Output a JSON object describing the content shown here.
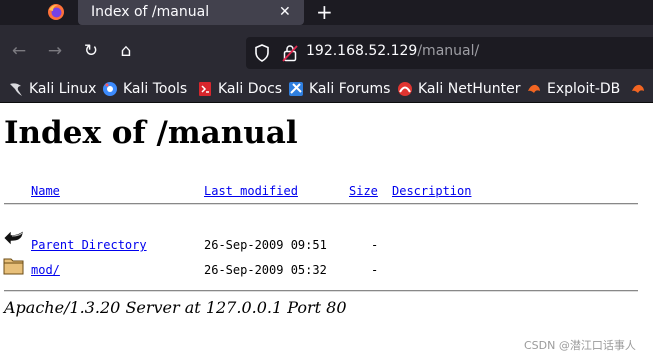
{
  "browser": {
    "tab": {
      "title": "Index of /manual",
      "close_glyph": "✕"
    },
    "new_tab_glyph": "+",
    "nav": {
      "back_glyph": "←",
      "forward_glyph": "→",
      "reload_glyph": "↻",
      "home_glyph": "⌂"
    },
    "url": {
      "host": "192.168.52.129",
      "path": "/manual/"
    },
    "bookmarks": [
      {
        "label": "Kali Linux",
        "icon": "kali-dragon-icon",
        "color": "#d9d9de"
      },
      {
        "label": "Kali Tools",
        "icon": "kali-tools-icon",
        "color": "#3d8bfd"
      },
      {
        "label": "Kali Docs",
        "icon": "kali-docs-icon",
        "color": "#d7262d"
      },
      {
        "label": "Kali Forums",
        "icon": "kali-forums-icon",
        "color": "#2f7fe0"
      },
      {
        "label": "Kali NetHunter",
        "icon": "kali-nethunter-icon",
        "color": "#e03531"
      },
      {
        "label": "Exploit-DB",
        "icon": "exploit-db-icon",
        "color": "#f26522"
      },
      {
        "label": "",
        "icon": "exploit-db-icon",
        "color": "#f26522"
      }
    ]
  },
  "page": {
    "title": "Index of /manual",
    "columns": {
      "name": "Name",
      "last_modified": "Last modified",
      "size": "Size",
      "description": "Description"
    },
    "rows": [
      {
        "icon": "back-arrow-icon",
        "name": "Parent Directory",
        "modified": "26-Sep-2009 09:51",
        "size": "-",
        "description": ""
      },
      {
        "icon": "folder-icon",
        "name": "mod/",
        "modified": "26-Sep-2009 05:32",
        "size": "-",
        "description": ""
      }
    ],
    "address": "Apache/1.3.20 Server at 127.0.0.1 Port 80"
  },
  "watermark": "CSDN @潜江口话事人",
  "colors": {
    "link": "#0000ee",
    "chrome_dark": "#1c1b22",
    "chrome": "#2b2a33",
    "tab_active": "#42414d"
  }
}
